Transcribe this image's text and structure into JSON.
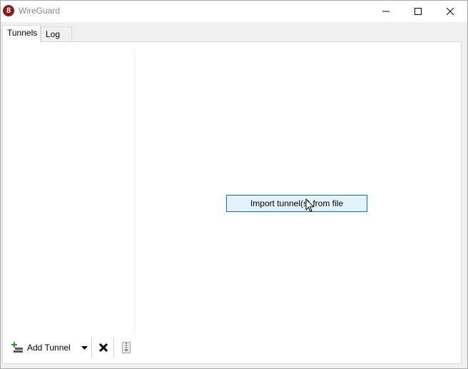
{
  "window": {
    "title": "WireGuard",
    "logo_icon": "wireguard-logo-icon",
    "controls": {
      "minimize_icon": "minimize-icon",
      "maximize_icon": "maximize-icon",
      "close_icon": "close-icon"
    }
  },
  "tabs": [
    {
      "label": "Tunnels",
      "active": true
    },
    {
      "label": "Log",
      "active": false
    }
  ],
  "main": {
    "import_button_label": "Import tunnel(s) from file"
  },
  "toolbar": {
    "add_tunnel_label": "Add Tunnel",
    "add_tunnel_icon": "add-tunnel-icon",
    "dropdown_icon": "dropdown-arrow-icon",
    "delete_icon": "delete-icon",
    "export_icon": "export-zip-icon"
  },
  "colors": {
    "accent": "#0078d7",
    "button_hover_bg": "#e5f1fb",
    "logo": "#8a1b1b",
    "add_icon_green": "#2e9a2e"
  }
}
